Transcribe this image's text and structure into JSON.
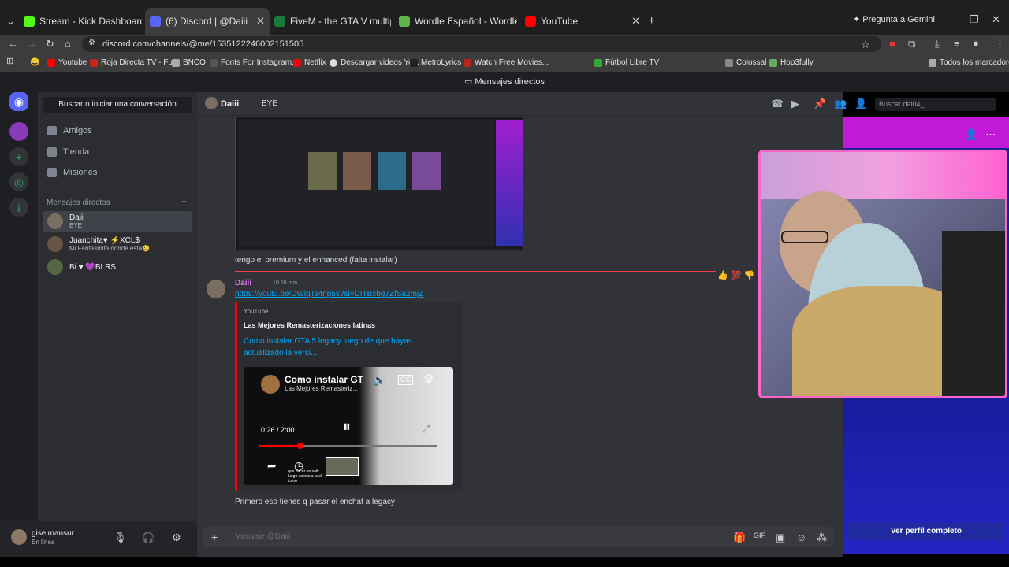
{
  "browser": {
    "tabs": [
      {
        "title": "Stream - Kick Dashboard",
        "color": "#53fc18"
      },
      {
        "title": "(6) Discord | @Daiii",
        "color": "#5865f2"
      },
      {
        "title": "FiveM - the GTA V multiplayer m",
        "color": "#1a7a3a"
      },
      {
        "title": "Wordle Español - Wordle ilimita",
        "color": "#5fb54a"
      },
      {
        "title": "YouTube",
        "color": "#ff0000"
      }
    ],
    "gemini": "Pregunta a Gemini",
    "url": "discord.com/channels/@me/1535122246002151505",
    "bookmarks": [
      "Youtube",
      "Roja Directa TV - Fu...",
      "BNCO",
      "Fonts For Instagram...",
      "Netflix",
      "Descargar videos Yo...",
      "MetroLyrics",
      "Watch Free Movies...",
      "Fútbol Libre TV",
      "Colossal",
      "Hop3fully"
    ],
    "all_bookmarks": "Todos los marcadores"
  },
  "discord": {
    "window_title": "Mensajes directos",
    "search_conv": "Buscar o iniciar una conversación",
    "nav": [
      "Amigos",
      "Tienda",
      "Misiones"
    ],
    "dm_header": "Mensajes directos",
    "dms": [
      {
        "name": "Daiii",
        "status": "BYE"
      },
      {
        "name": "Juanchita♥  ⚡XCL$",
        "status": "Mi Fantasmita donde esta😀"
      },
      {
        "name": "Bi ♥  💜BLRS",
        "status": ""
      }
    ],
    "user": {
      "name": "giselmansur",
      "status": "En línea"
    },
    "channel": {
      "name": "Daiii",
      "status": "BYE",
      "search_placeholder": "Buscar dai04_"
    },
    "messages": {
      "msg1": "tengo el premium y el enhanced (falta instalar)",
      "author": "Daiii",
      "time": "10:59 p.m.",
      "link": "https://youtu.be/DWlqTs4np5s?si=DITBxbg7ZfSa2mjZ",
      "embed_provider": "YouTube",
      "embed_author": "Las Mejores Remasterizaciones latinas",
      "embed_title": "Como instalar GTA 5 legacy luego de que hayas actualizado la versi...",
      "video_title": "Como instalar GT",
      "video_channel": "Las Mejores Remasteriz...",
      "video_time": "0:26 / 2:00",
      "video_caption": "que hacer en salir luego vamos a la el icono",
      "msg2": "Primero eso tienes q pasar el enchat a legacy"
    },
    "composer_placeholder": "Mensaje @Daiii",
    "profile_button": "Ver perfil completo"
  }
}
